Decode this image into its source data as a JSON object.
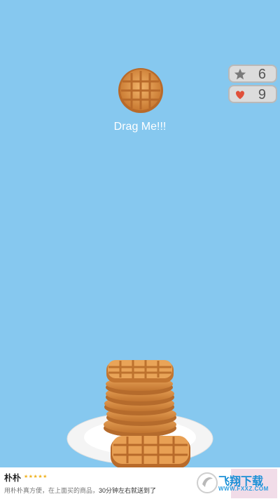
{
  "game": {
    "drag_label": "Drag Me!!!",
    "stars": "6",
    "lives": "9"
  },
  "icons": {
    "star": "star-icon",
    "heart": "heart-icon"
  },
  "colors": {
    "background": "#86c8ef",
    "waffle": "#e09a4d",
    "heart": "#e0503a"
  },
  "ad": {
    "title": "朴朴",
    "rating": "★★★★★",
    "desc_pre": "用朴朴真方便，在上面买的商品，",
    "desc_highlight": "30分钟左右就送到了",
    "logo_text": "飞翔下载",
    "logo_url": "WWW.FXXZ.COM"
  }
}
